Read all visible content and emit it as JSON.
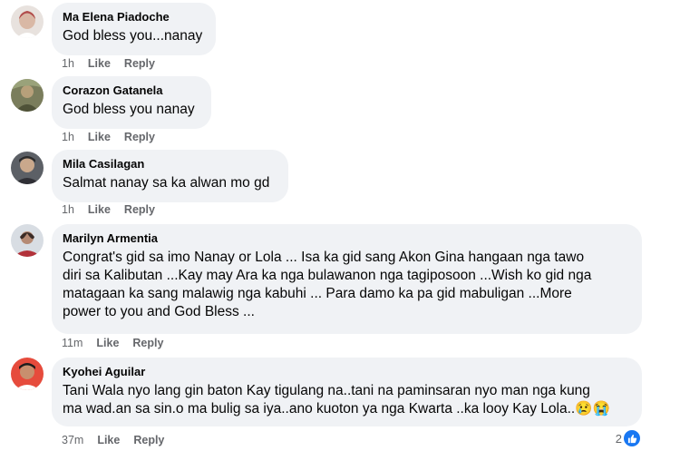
{
  "comments": [
    {
      "name": "Ma Elena Piadoche",
      "lines": [
        "God bless you...nanay"
      ],
      "time": "1h",
      "like": "Like",
      "reply": "Reply"
    },
    {
      "name": "Corazon Gatanela",
      "lines": [
        "God bless you nanay"
      ],
      "time": "1h",
      "like": "Like",
      "reply": "Reply"
    },
    {
      "name": "Mila Casilagan",
      "lines": [
        "Salmat nanay sa ka alwan mo gd"
      ],
      "time": "1h",
      "like": "Like",
      "reply": "Reply"
    },
    {
      "name": "Marilyn Armentia",
      "lines": [
        "Congrat's gid sa imo Nanay or Lola ... Isa ka gid sang Akon Gina hangaan nga tawo",
        "diri sa Kalibutan ...Kay may Ara ka nga bulawanon nga tagiposoon ...Wish ko gid nga",
        "matagaan ka sang malawig nga kabuhi ... Para damo ka pa gid mabuligan ...More",
        "power to you and God Bless ..."
      ],
      "time": "11m",
      "like": "Like",
      "reply": "Reply"
    },
    {
      "name": "Kyohei Aguilar",
      "lines": [
        "Tani Wala nyo lang gin baton Kay tigulang na..tani na paminsaran nyo man nga kung",
        "ma wad.an sa sin.o ma bulig sa iya..ano kuoton ya nga Kwarta ..ka looy Kay Lola..😢😭"
      ],
      "time": "37m",
      "like": "Like",
      "reply": "Reply",
      "reaction_count": "2"
    }
  ],
  "colors": {
    "bubble": "#f0f2f5",
    "meta": "#65676b",
    "accent": "#1877f2"
  }
}
